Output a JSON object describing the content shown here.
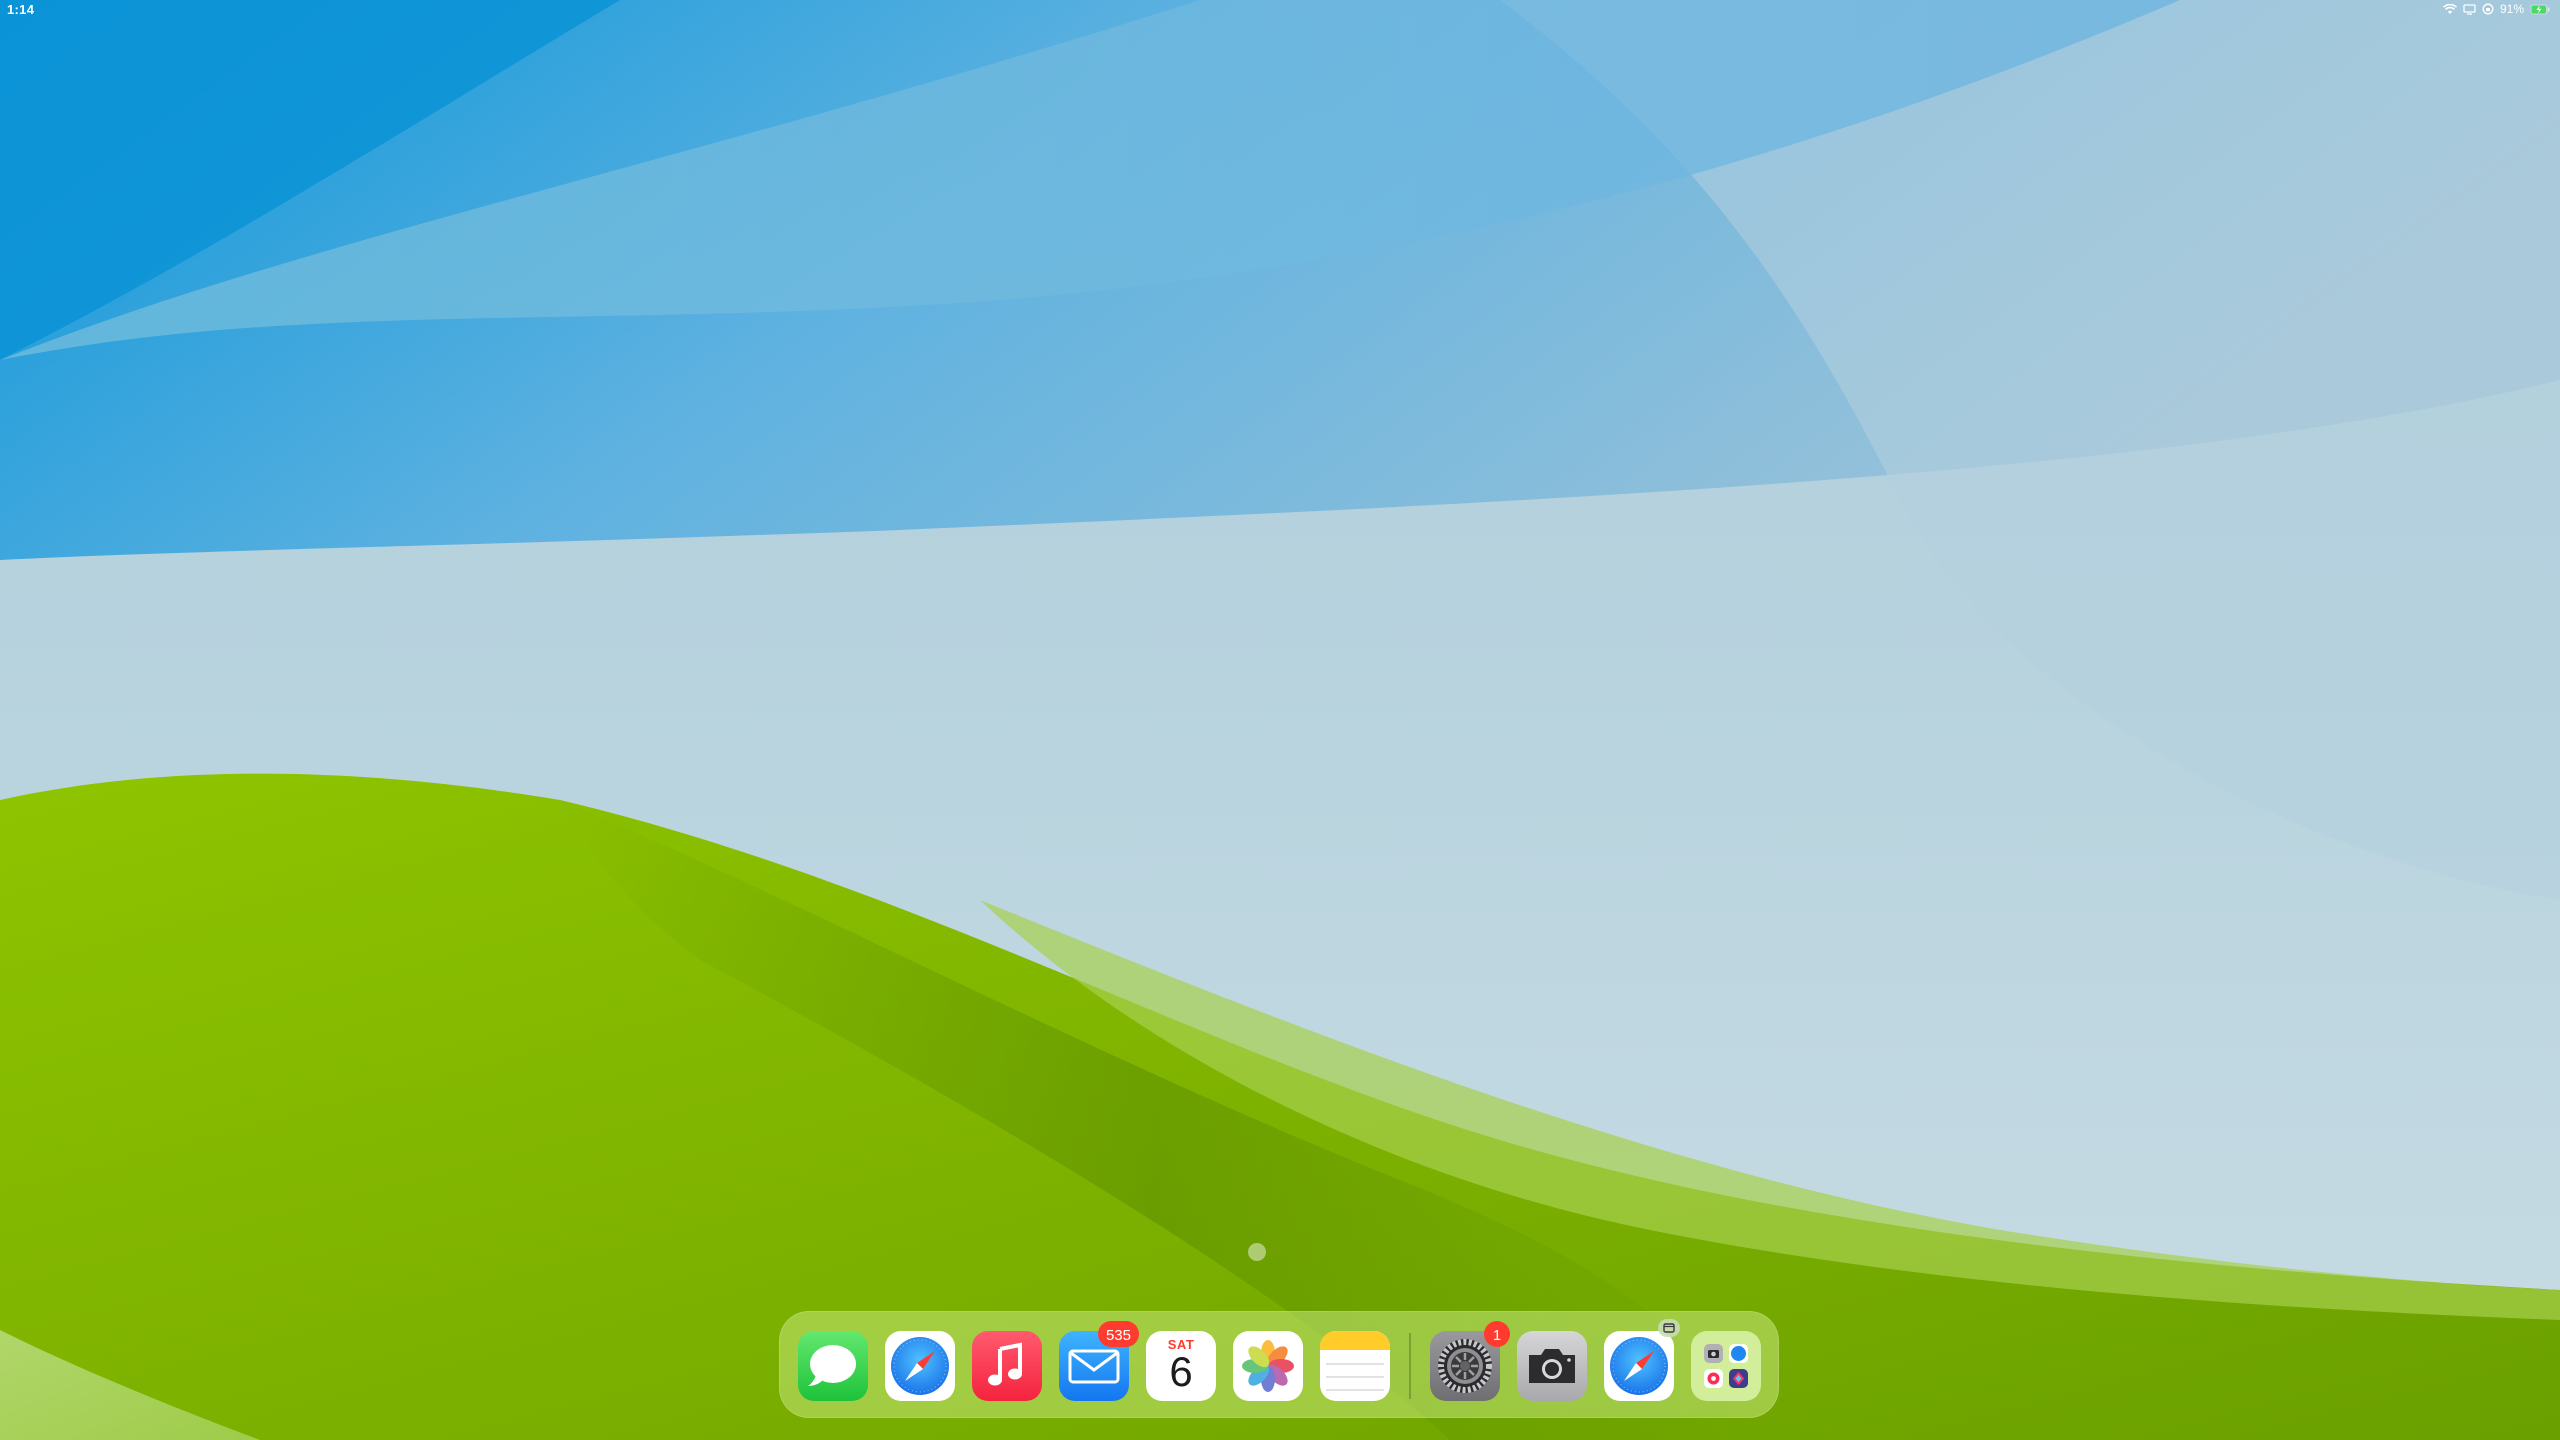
{
  "status_bar": {
    "time": "1:14",
    "battery_percent": "91%",
    "icons": [
      "wifi-icon",
      "screen-mirroring-icon",
      "orientation-lock-icon",
      "battery-charging-icon"
    ]
  },
  "home": {
    "page_count": 1,
    "current_page": 1
  },
  "dock": {
    "apps": [
      {
        "name": "Messages",
        "icon": "messages-icon"
      },
      {
        "name": "Safari",
        "icon": "safari-icon"
      },
      {
        "name": "Music",
        "icon": "music-icon"
      },
      {
        "name": "Mail",
        "icon": "mail-icon",
        "badge": "535"
      },
      {
        "name": "Calendar",
        "icon": "calendar-icon",
        "day": "SAT",
        "date": "6"
      },
      {
        "name": "Photos",
        "icon": "photos-icon"
      },
      {
        "name": "Notes",
        "icon": "notes-icon"
      }
    ],
    "recent_apps": [
      {
        "name": "Settings",
        "icon": "settings-icon",
        "badge": "1"
      },
      {
        "name": "Camera",
        "icon": "camera-icon"
      },
      {
        "name": "Safari",
        "icon": "safari-icon",
        "indicator": "multi-window-icon"
      },
      {
        "name": "App Library",
        "icon": "app-library-icon"
      }
    ]
  },
  "colors": {
    "sky_blue": "#5fb0e0",
    "grass_green": "#86bb00",
    "badge_red": "#ff3b30"
  }
}
